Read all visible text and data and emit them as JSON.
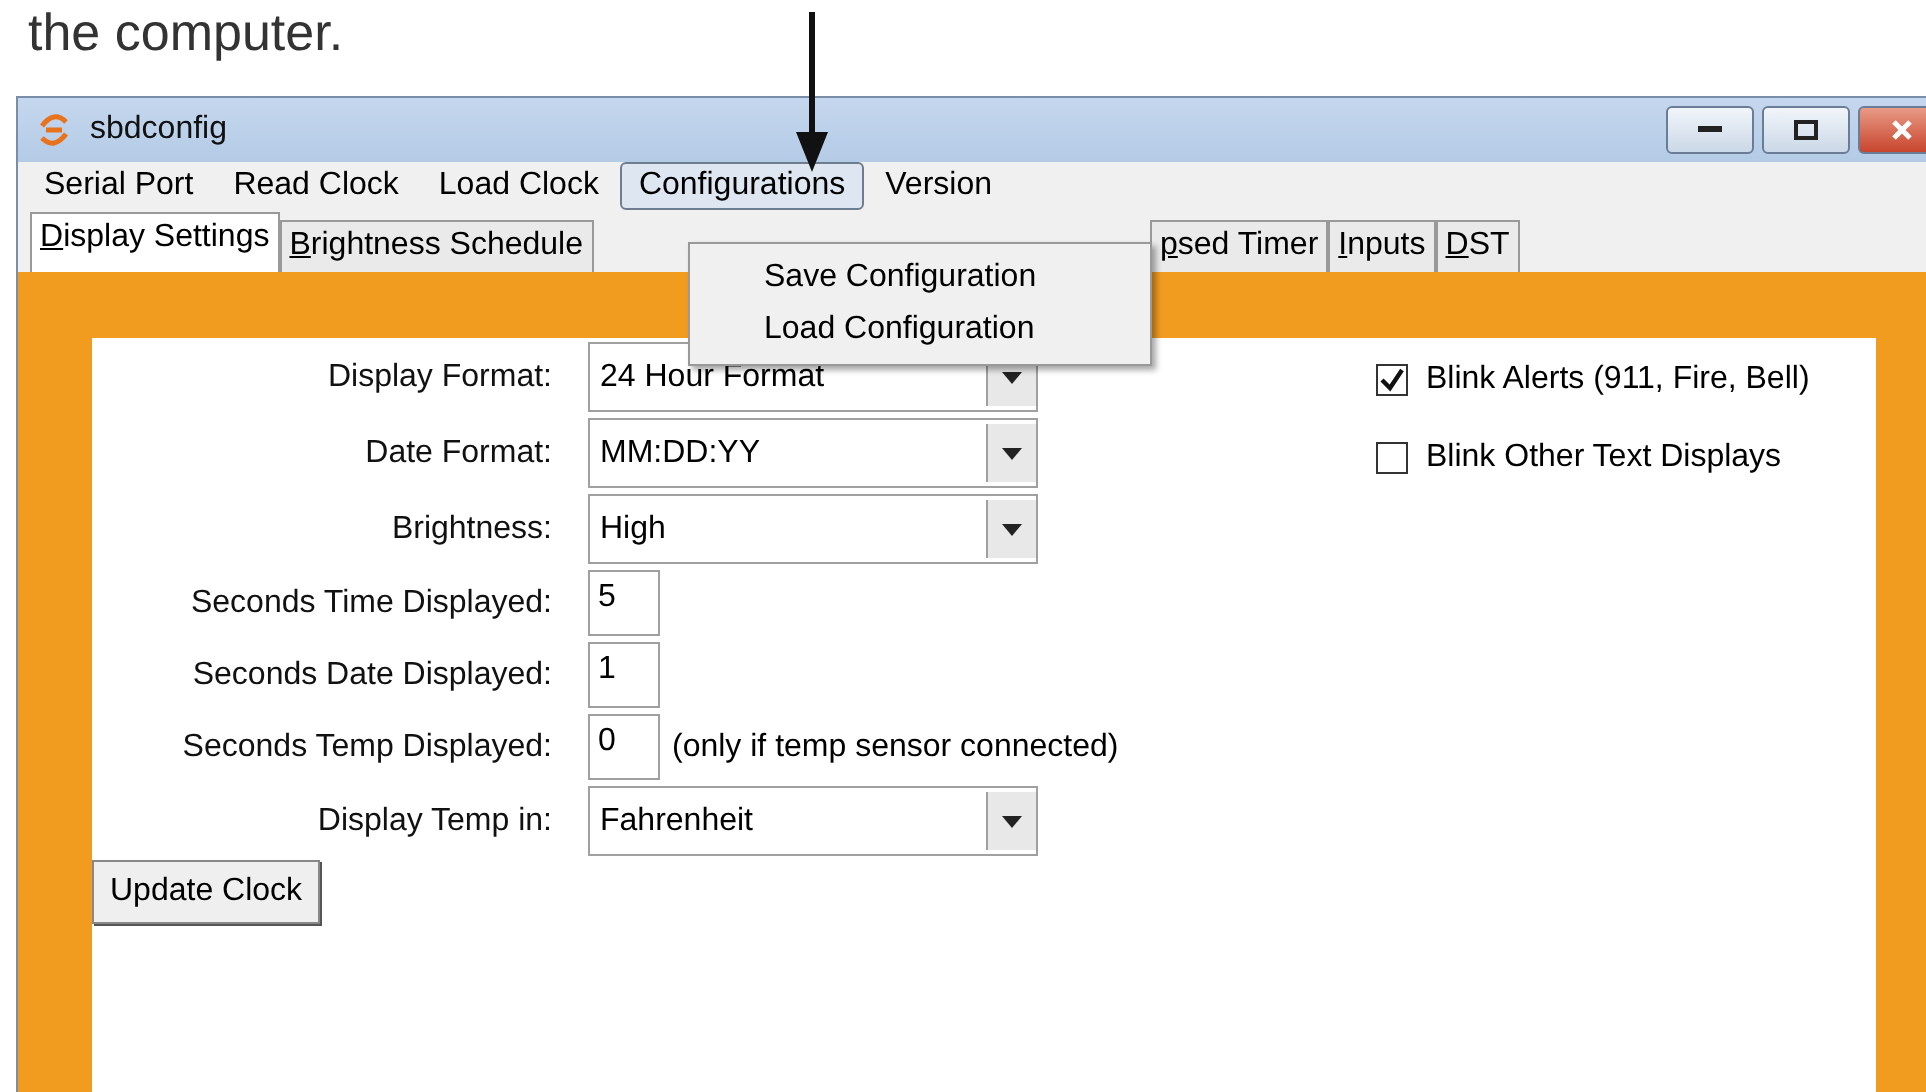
{
  "doc_text": "the computer.",
  "window": {
    "title": "sbdconfig"
  },
  "menu": [
    {
      "label": "Serial Port",
      "selected": false
    },
    {
      "label": "Read Clock",
      "selected": false
    },
    {
      "label": "Load Clock",
      "selected": false
    },
    {
      "label": "Configurations",
      "selected": true
    },
    {
      "label": "Version",
      "selected": false
    }
  ],
  "dropdown_menu": [
    "Save Configuration",
    "Load Configuration"
  ],
  "tabs": [
    {
      "label": "Display Settings",
      "selected": true
    },
    {
      "label": "Brightness Schedule",
      "selected": false
    },
    {
      "label": "psed Timer",
      "selected": false
    },
    {
      "label": "Inputs",
      "selected": false
    },
    {
      "label": "DST",
      "selected": false
    }
  ],
  "fields": [
    {
      "label": "Display Format:",
      "kind": "combo",
      "value": "24 Hour Format"
    },
    {
      "label": "Date Format:",
      "kind": "combo",
      "value": "MM:DD:YY"
    },
    {
      "label": "Brightness:",
      "kind": "combo",
      "value": "High"
    },
    {
      "label": "Seconds Time Displayed:",
      "kind": "number",
      "value": "5"
    },
    {
      "label": "Seconds Date Displayed:",
      "kind": "number",
      "value": "1"
    },
    {
      "label": "Seconds Temp Displayed:",
      "kind": "number",
      "value": "0",
      "note": "(only if temp sensor connected)"
    },
    {
      "label": "Display Temp in:",
      "kind": "combo",
      "value": "Fahrenheit"
    }
  ],
  "checkboxes": [
    {
      "label": "Blink Alerts (911, Fire, Bell)",
      "checked": true
    },
    {
      "label": "Blink Other Text Displays",
      "checked": false
    }
  ],
  "button": "Update Clock"
}
